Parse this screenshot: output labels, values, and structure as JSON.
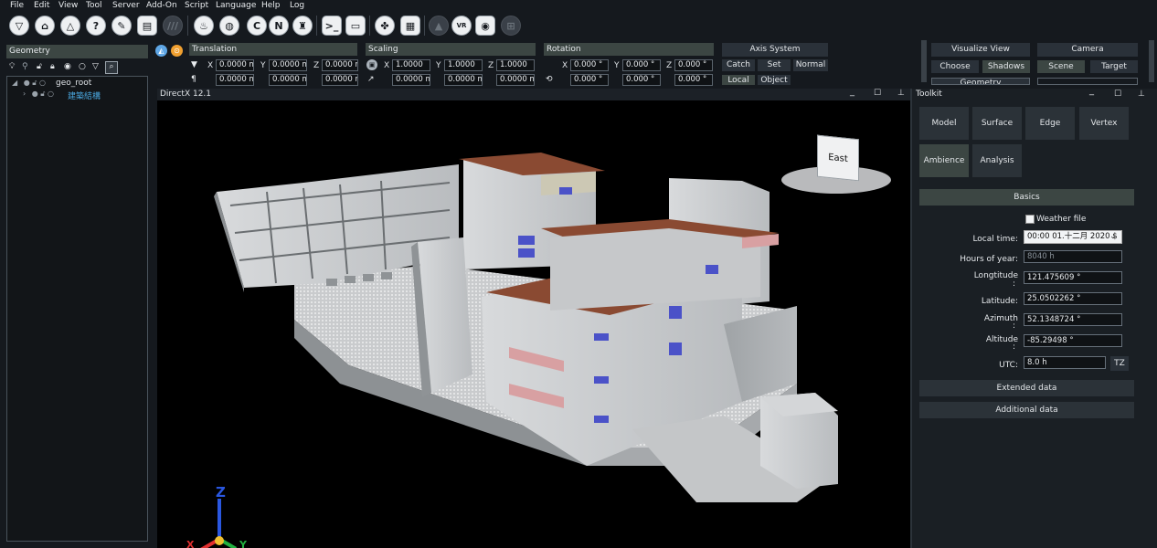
{
  "menu": [
    "File",
    "Edit",
    "View",
    "Tool",
    "Server",
    "Add-On",
    "Script",
    "Language",
    "Help",
    "Log"
  ],
  "toolbar": {
    "buttons": [
      "shader-icon",
      "home-icon",
      "house-outline-icon",
      "help-icon",
      "pencil-ruler-icon",
      "document-icon",
      "hatch-icon",
      "fire-icon",
      "globe-icon",
      "refresh-c-icon",
      "n-icon",
      "brush-icon",
      "console-icon",
      "window-icon",
      "figure-icon",
      "grid-icon",
      "terrain-icon",
      "vr-icon",
      "camera-icon",
      "map-icon"
    ],
    "vr_label": "VR"
  },
  "geometry": {
    "title": "Geometry",
    "tree": [
      {
        "label": "geo_root",
        "color": "#dfe3e7"
      },
      {
        "label": "建築結構",
        "color": "#4aa8e0"
      }
    ]
  },
  "transform": {
    "translation": {
      "title": "Translation",
      "row1": [
        "0.0000 m",
        "0.0000 m",
        "0.0000 m"
      ],
      "row2": [
        "0.0000 m",
        "0.0000 m",
        "0.0000 m"
      ]
    },
    "scaling": {
      "title": "Scaling",
      "row1": [
        "1.0000",
        "1.0000",
        "1.0000"
      ],
      "row2": [
        "0.0000 m",
        "0.0000 m",
        "0.0000 m"
      ]
    },
    "rotation": {
      "title": "Rotation",
      "row1": [
        "0.000 °",
        "0.000 °",
        "0.000 °"
      ],
      "row2": [
        "0.000 °",
        "0.000 °",
        "0.000 °"
      ]
    },
    "axes": [
      "X",
      "Y",
      "Z"
    ]
  },
  "axis_system": {
    "title": "Axis System",
    "buttons": [
      "Catch",
      "Set",
      "Normal"
    ],
    "buttons2": [
      "Local",
      "Object"
    ]
  },
  "visualize": {
    "title": "Visualize View",
    "buttons": [
      "Choose",
      "Shadows"
    ],
    "cut_label": "Geometry"
  },
  "camera": {
    "title": "Camera",
    "buttons": [
      "Scene",
      "Target"
    ]
  },
  "viewport": {
    "title": "DirectX 12.1",
    "cube_label": "East",
    "axis_z": "Z",
    "axis_y": "Y",
    "axis_x": "X"
  },
  "toolkit": {
    "title": "Toolkit",
    "tabs": [
      "Model",
      "Surface",
      "Edge",
      "Vertex",
      "Ambience",
      "Analysis"
    ],
    "basics": "Basics",
    "weather_file": "Weather file",
    "local_time_label": "Local time:",
    "local_time_value": "00:00 01.十二月 2020 $",
    "hours_label": "Hours of year:",
    "hours_value": "8040 h",
    "longitude_label": "Longtitude",
    "longitude_value": "121.475609 °",
    "latitude_label": "Latitude:",
    "latitude_value": "25.0502262 °",
    "azimuth_label": "Azimuth",
    "azimuth_value": "52.1348724 °",
    "altitude_label": "Altitude",
    "altitude_value": "-85.29498 °",
    "utc_label": "UTC:",
    "utc_value": "8.0 h",
    "tz_button": "TZ",
    "extended": "Extended data",
    "additional": "Additional data",
    "colon": ":"
  },
  "colors": {
    "panel_active": "#3c4643",
    "background": "#15191e",
    "accent_blue": "#4aa8e0",
    "roof": "#8a4a32"
  }
}
